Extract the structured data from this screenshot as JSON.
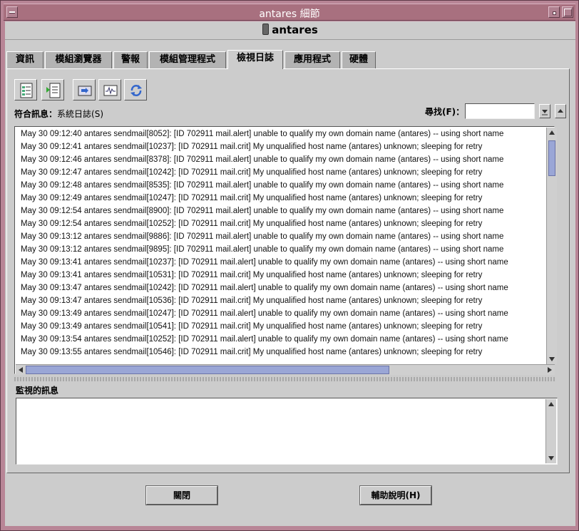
{
  "window": {
    "title": "antares 細節"
  },
  "host": {
    "name": "antares"
  },
  "tabs": [
    {
      "label": "資訊"
    },
    {
      "label": "模組瀏覽器"
    },
    {
      "label": "警報"
    },
    {
      "label": "模組管理程式"
    },
    {
      "label": "檢視日誌"
    },
    {
      "label": "應用程式"
    },
    {
      "label": "硬體"
    }
  ],
  "toolbar": {
    "icons": [
      "log-details-icon",
      "log-view-icon",
      "import-icon",
      "monitor-icon",
      "refresh-icon"
    ]
  },
  "matching": {
    "label": "符合訊息：",
    "value": "系統日誌(S)"
  },
  "search": {
    "label": "尋找(F)：",
    "value": ""
  },
  "log_lines": [
    "May 30 09:12:40 antares sendmail[8052]: [ID 702911 mail.alert] unable to qualify my own domain name (antares) -- using short name",
    "May 30 09:12:41 antares sendmail[10237]: [ID 702911 mail.crit] My unqualified host name (antares) unknown; sleeping for retry",
    "May 30 09:12:46 antares sendmail[8378]: [ID 702911 mail.alert] unable to qualify my own domain name (antares) -- using short name",
    "May 30 09:12:47 antares sendmail[10242]: [ID 702911 mail.crit] My unqualified host name (antares) unknown; sleeping for retry",
    "May 30 09:12:48 antares sendmail[8535]: [ID 702911 mail.alert] unable to qualify my own domain name (antares) -- using short name",
    "May 30 09:12:49 antares sendmail[10247]: [ID 702911 mail.crit] My unqualified host name (antares) unknown; sleeping for retry",
    "May 30 09:12:54 antares sendmail[8900]: [ID 702911 mail.alert] unable to qualify my own domain name (antares) -- using short name",
    "May 30 09:12:54 antares sendmail[10252]: [ID 702911 mail.crit] My unqualified host name (antares) unknown; sleeping for retry",
    "May 30 09:13:12 antares sendmail[9886]: [ID 702911 mail.alert] unable to qualify my own domain name (antares) -- using short name",
    "May 30 09:13:12 antares sendmail[9895]: [ID 702911 mail.alert] unable to qualify my own domain name (antares) -- using short name",
    "May 30 09:13:41 antares sendmail[10237]: [ID 702911 mail.alert] unable to qualify my own domain name (antares) -- using short name",
    "May 30 09:13:41 antares sendmail[10531]: [ID 702911 mail.crit] My unqualified host name (antares) unknown; sleeping for retry",
    "May 30 09:13:47 antares sendmail[10242]: [ID 702911 mail.alert] unable to qualify my own domain name (antares) -- using short name",
    "May 30 09:13:47 antares sendmail[10536]: [ID 702911 mail.crit] My unqualified host name (antares) unknown; sleeping for retry",
    "May 30 09:13:49 antares sendmail[10247]: [ID 702911 mail.alert] unable to qualify my own domain name (antares) -- using short name",
    "May 30 09:13:49 antares sendmail[10541]: [ID 702911 mail.crit] My unqualified host name (antares) unknown; sleeping for retry",
    "May 30 09:13:54 antares sendmail[10252]: [ID 702911 mail.alert] unable to qualify my own domain name (antares) -- using short name",
    "May 30 09:13:55 antares sendmail[10546]: [ID 702911 mail.crit] My unqualified host name (antares) unknown; sleeping for retry"
  ],
  "monitor": {
    "label": "監視的訊息",
    "value": ""
  },
  "buttons": {
    "close": "關閉",
    "help": "輔助說明(H)"
  },
  "colors": {
    "titlebar": "#a8707f",
    "frame": "#b88596",
    "panel": "#cccccc",
    "scroll_thumb": "#9aa6d6"
  }
}
